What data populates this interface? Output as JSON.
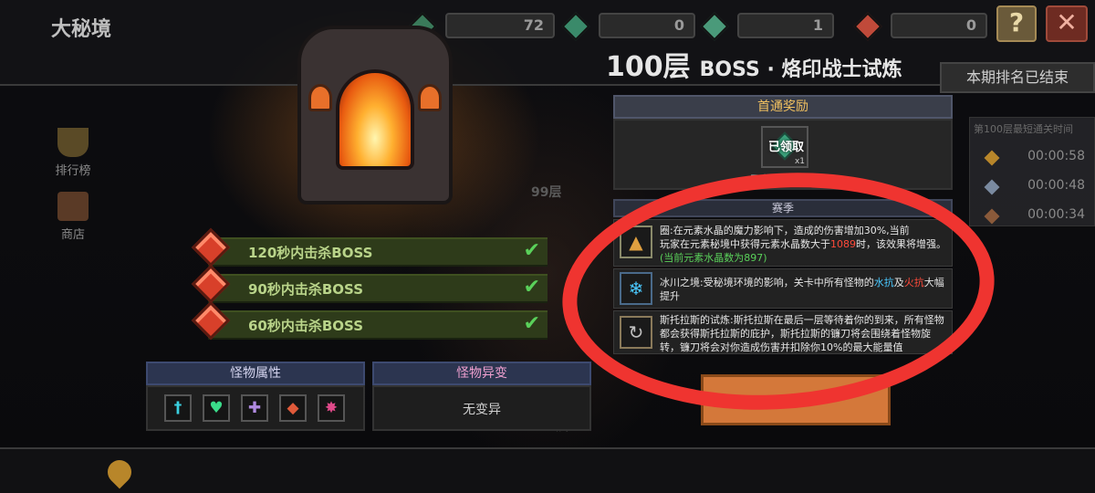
{
  "header": {
    "title": "大秘境",
    "counters": [
      "72",
      "0",
      "1",
      "0"
    ],
    "help_label": "?",
    "close_label": "✕"
  },
  "boss": {
    "floor": "100层",
    "name": "BOSS · 烙印战士试炼"
  },
  "ranking_status": "本期排名已结束",
  "sidebar": [
    {
      "label": "排行榜",
      "icon": "trophy-icon"
    },
    {
      "label": "商店",
      "icon": "shop-icon"
    }
  ],
  "floor_labels": [
    "99层",
    "100层"
  ],
  "conditions": [
    {
      "label": "120秒内击杀BOSS",
      "done": true
    },
    {
      "label": "90秒内击杀BOSS",
      "done": true
    },
    {
      "label": "60秒内击杀BOSS",
      "done": true
    }
  ],
  "monster_attributes": {
    "title": "怪物属性",
    "icons": [
      {
        "name": "sword-icon",
        "glyph": "†",
        "color": "#3ad0e0"
      },
      {
        "name": "heart-icon",
        "glyph": "♥",
        "color": "#3adc8a"
      },
      {
        "name": "shield-icon",
        "glyph": "✚",
        "color": "#b08ae0"
      },
      {
        "name": "split-icon",
        "glyph": "◆",
        "color": "#e05a3a"
      },
      {
        "name": "crest-icon",
        "glyph": "✸",
        "color": "#e04a8a"
      }
    ]
  },
  "monster_mutation": {
    "title": "怪物异变",
    "value": "无变异"
  },
  "first_clear_reward": {
    "title": "首通奖励",
    "item_status": "已领取",
    "item_qty": "x1",
    "caption": "已获得首通奖"
  },
  "rules_header": "赛季",
  "rules": [
    {
      "icon": "crystal-icon",
      "text_a": "圈:在元素水晶的魔力影响下，造成的伤害增加30%,当前",
      "text_b": "玩家在元素秘境中获得元素水晶数大于",
      "highlight_number": "1089",
      "text_c": "时，该效果将增强。",
      "current": "(当前元素水晶数为897)"
    },
    {
      "icon": "ice-icon",
      "text_a": "冰川之境:受秘境环境的影响，关卡中所有怪物的",
      "highlight_water": "水抗",
      "text_mid": "及",
      "highlight_fire": "火抗",
      "text_c": "大幅提升"
    },
    {
      "icon": "scythe-icon",
      "text": "斯托拉斯的试炼:斯托拉斯在最后一层等待着你的到来，所有怪物都会获得斯托拉斯的庇护，斯托拉斯的镰刀将会围绕着怪物旋转，镰刀将会对你造成伤害并扣除你10%的最大能量值"
    }
  ],
  "clear_times": {
    "label": "第100层最短通关时间",
    "values": [
      "00:00:58",
      "00:00:48",
      "00:00:34"
    ]
  },
  "colors": {
    "annotation_circle": "#ef3430",
    "condition_green": "#b9d48a",
    "check_green": "#5ad05a"
  }
}
